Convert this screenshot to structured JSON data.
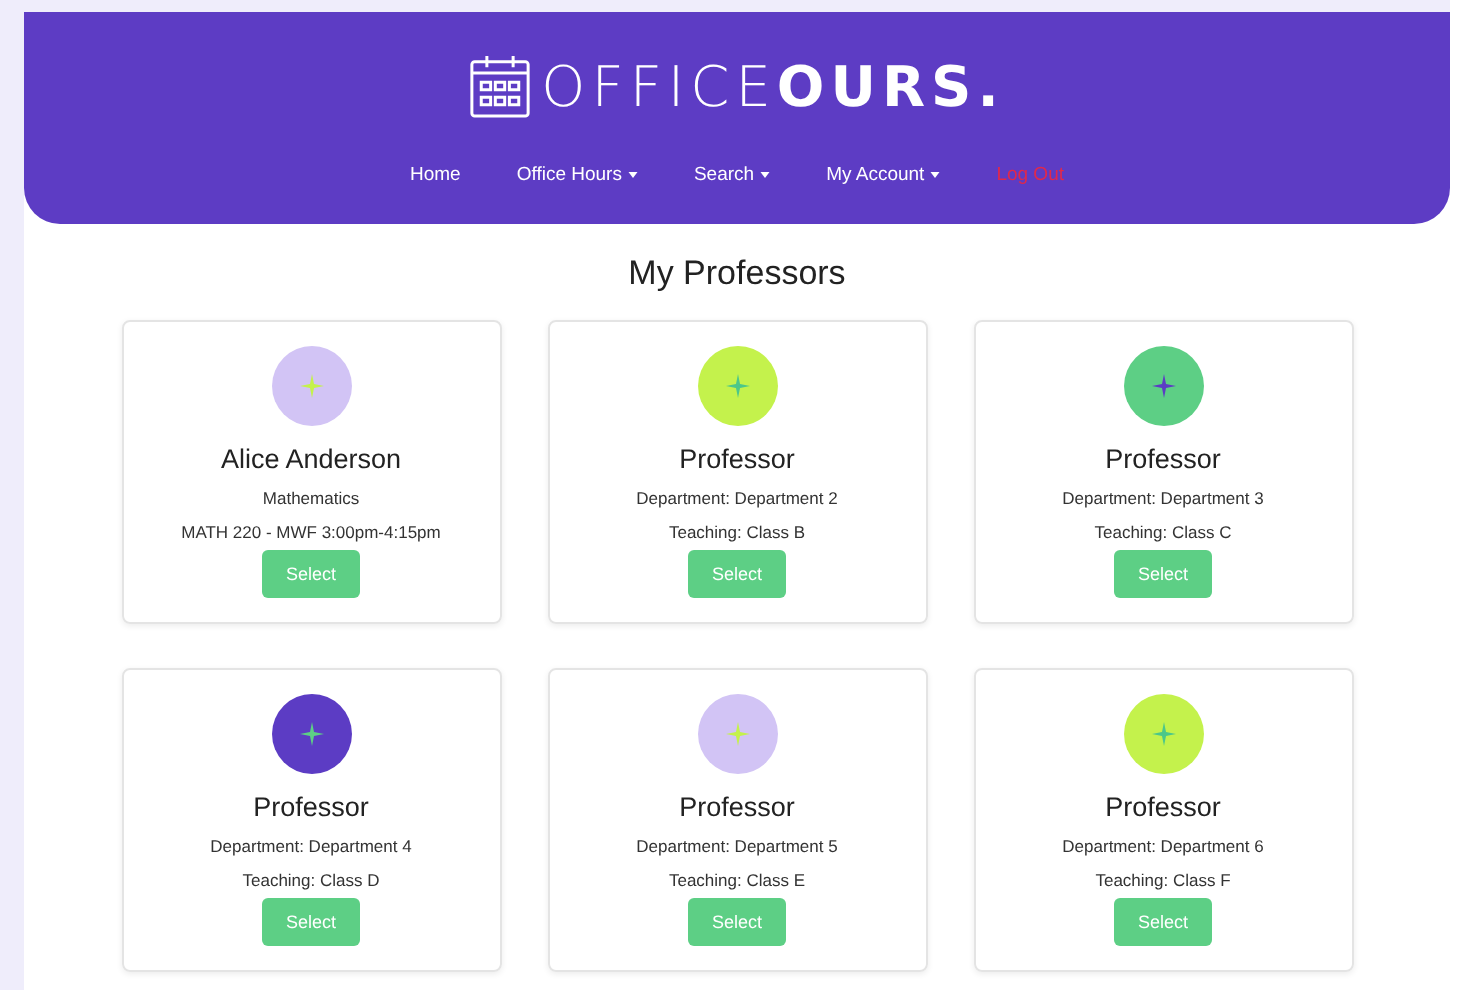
{
  "header": {
    "logo_light": "OFFICE",
    "logo_bold": "OURS."
  },
  "nav": [
    {
      "label": "Home",
      "kind": "link"
    },
    {
      "label": "Office Hours",
      "kind": "dropdown"
    },
    {
      "label": "Search",
      "kind": "dropdown"
    },
    {
      "label": "My Account",
      "kind": "dropdown"
    },
    {
      "label": "Log Out",
      "kind": "logout"
    }
  ],
  "heading": "My Professors",
  "cards": [
    {
      "name": "Alice Anderson",
      "color": "#d2c4f5",
      "sparkle": {
        "color": "#c4f24c"
      },
      "lines": [
        "Mathematics",
        "MATH 220 - MWF 3:00pm-4:15pm"
      ],
      "button": "Select"
    },
    {
      "name": "Professor",
      "color": "#c4f24c",
      "sparkle": {
        "color": "#4cc78a"
      },
      "lines": [
        "Department: Department 2",
        "Teaching: Class B"
      ],
      "button": "Select"
    },
    {
      "name": "Professor",
      "color": "#5dcf85",
      "sparkle": {
        "color": "#5c3cc4"
      },
      "lines": [
        "Department: Department 3",
        "Teaching: Class C"
      ],
      "button": "Select"
    },
    {
      "name": "Professor",
      "color": "#5c3cc4",
      "sparkle": {
        "color": "#5dcf85"
      },
      "lines": [
        "Department: Department 4",
        "Teaching: Class D"
      ],
      "button": "Select"
    },
    {
      "name": "Professor",
      "color": "#d2c4f5",
      "sparkle": {
        "color": "#c4f24c"
      },
      "lines": [
        "Department: Department 5",
        "Teaching: Class E"
      ],
      "button": "Select"
    },
    {
      "name": "Professor",
      "color": "#c4f24c",
      "sparkle": {
        "color": "#4cc78a"
      },
      "lines": [
        "Department: Department 6",
        "Teaching: Class F"
      ],
      "button": "Select"
    }
  ]
}
